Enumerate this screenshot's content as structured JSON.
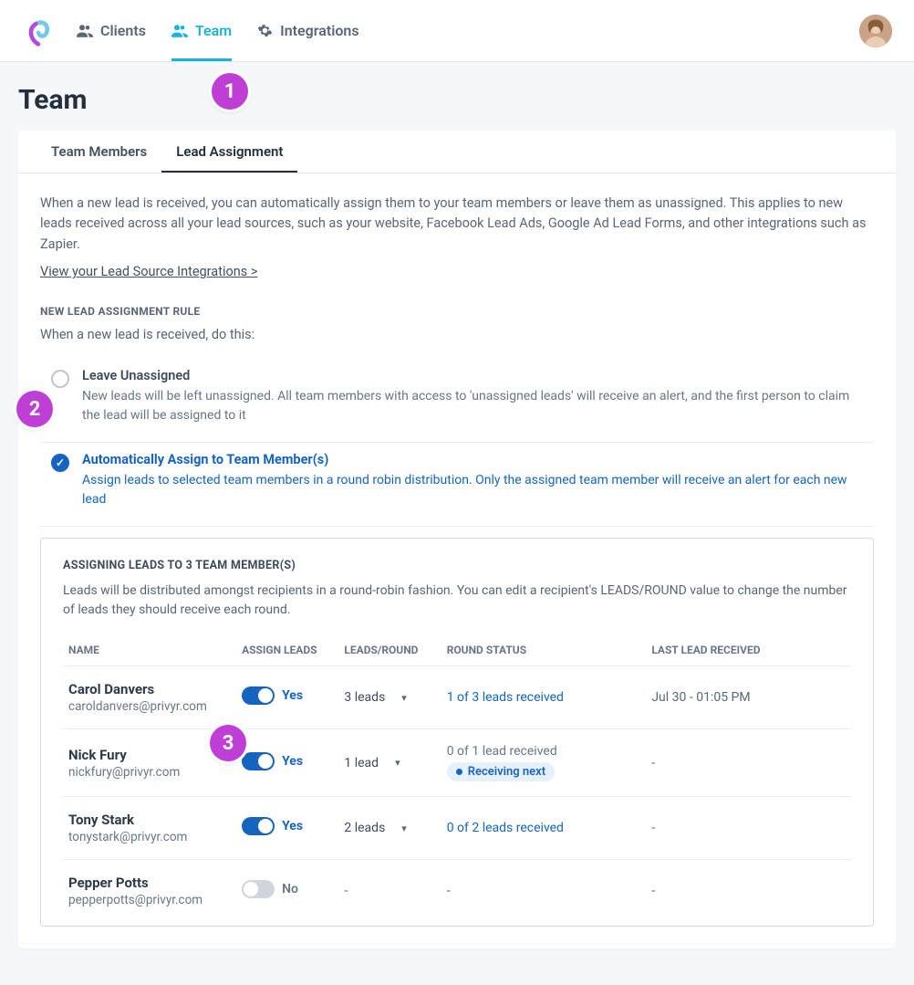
{
  "nav": {
    "clients": "Clients",
    "team": "Team",
    "integrations": "Integrations"
  },
  "page_title": "Team",
  "tabs": {
    "team_members": "Team Members",
    "lead_assignment": "Lead Assignment"
  },
  "intro_text": "When a new lead is received, you can automatically assign them to your team members or leave them as unassigned. This applies to new leads received across all your lead sources, such as your website, Facebook Lead Ads, Google Ad Lead Forms, and other integrations such as Zapier.",
  "link_text": "View your Lead Source Integrations >",
  "section_heading": "NEW LEAD ASSIGNMENT RULE",
  "rule_intro": "When a new lead is received, do this:",
  "options": {
    "unassigned": {
      "title": "Leave Unassigned",
      "desc": "New leads will be left unassigned. All team members with access to 'unassigned leads' will receive an alert, and the first person to claim the lead will be assigned to it"
    },
    "auto": {
      "title": "Automatically Assign to Team Member(s)",
      "desc": "Assign leads to selected team members in a round robin distribution. Only the assigned team member will receive an alert for each new lead"
    }
  },
  "assign_box": {
    "title": "ASSIGNING LEADS TO 3 TEAM MEMBER(S)",
    "desc": "Leads will be distributed amongst recipients in a round-robin fashion. You can edit a recipient's LEADS/ROUND value to change the number of leads they should receive each round.",
    "columns": {
      "name": "NAME",
      "assign": "ASSIGN LEADS",
      "per_round": "LEADS/ROUND",
      "status": "ROUND STATUS",
      "last": "LAST LEAD RECEIVED"
    }
  },
  "toggle_labels": {
    "yes": "Yes",
    "no": "No"
  },
  "receiving_next": "Receiving next",
  "members": [
    {
      "name": "Carol Danvers",
      "email": "caroldanvers@privyr.com",
      "assign": true,
      "leads_per_round": "3 leads",
      "round_status": "1 of 3 leads received",
      "receiving_next": false,
      "last_received": "Jul 30 - 01:05 PM"
    },
    {
      "name": "Nick Fury",
      "email": "nickfury@privyr.com",
      "assign": true,
      "leads_per_round": "1 lead",
      "round_status": "0 of 1 lead received",
      "receiving_next": true,
      "last_received": "-"
    },
    {
      "name": "Tony Stark",
      "email": "tonystark@privyr.com",
      "assign": true,
      "leads_per_round": "2 leads",
      "round_status": "0 of 2 leads received",
      "receiving_next": false,
      "last_received": "-"
    },
    {
      "name": "Pepper Potts",
      "email": "pepperpotts@privyr.com",
      "assign": false,
      "leads_per_round": "-",
      "round_status": "-",
      "receiving_next": false,
      "last_received": "-"
    }
  ],
  "callouts": {
    "1": "1",
    "2": "2",
    "3": "3"
  }
}
